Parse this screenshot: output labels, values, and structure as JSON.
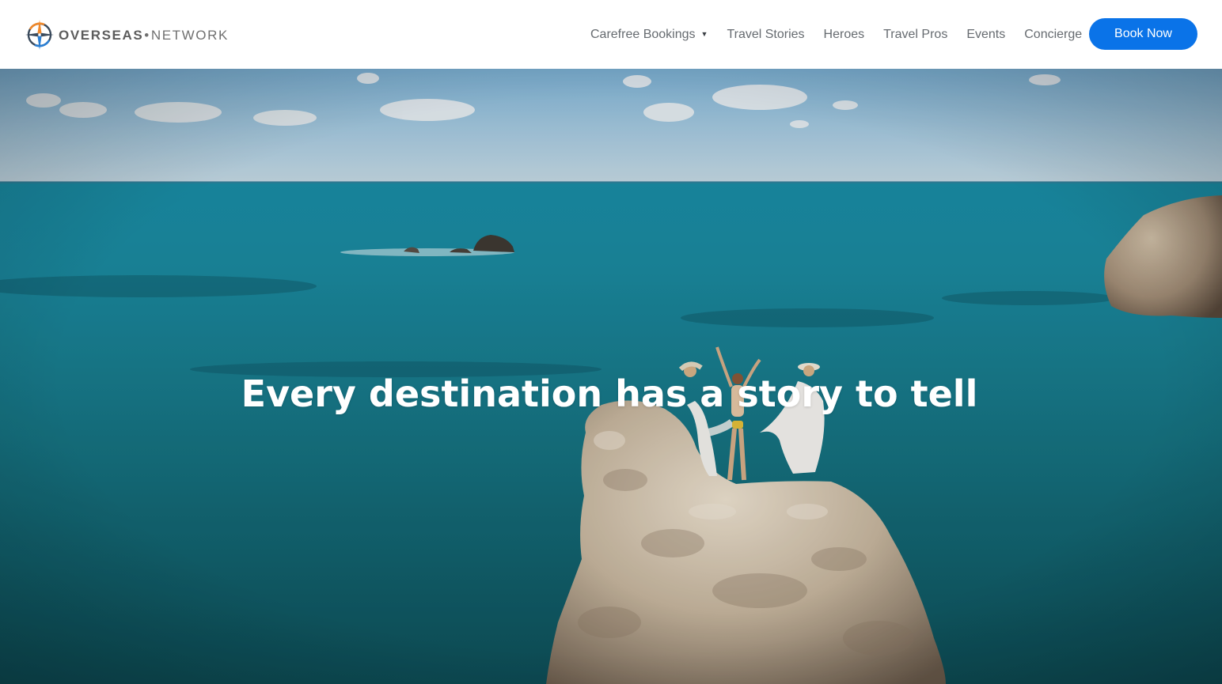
{
  "brand": {
    "name_strong": "OVERSEAS",
    "separator": "•",
    "name_light": "NETWORK",
    "logo_icon": "compass-icon",
    "colors": {
      "orange": "#f0882a",
      "blue": "#2a7fd4",
      "navy": "#3a4a5c"
    }
  },
  "nav": {
    "items": [
      {
        "label": "Carefree Bookings",
        "has_dropdown": true,
        "dropdown_icon": "caret-down-icon"
      },
      {
        "label": "Travel Stories"
      },
      {
        "label": "Heroes"
      },
      {
        "label": "Travel Pros"
      },
      {
        "label": "Events"
      },
      {
        "label": "Concierge"
      }
    ],
    "caret_glyph": "▼"
  },
  "cta": {
    "label": "Book Now",
    "color": "#0a73e8"
  },
  "hero": {
    "headline": "Every destination has a story to tell",
    "image_alt": "Aerial view of women standing on a rock in turquoise sea"
  }
}
